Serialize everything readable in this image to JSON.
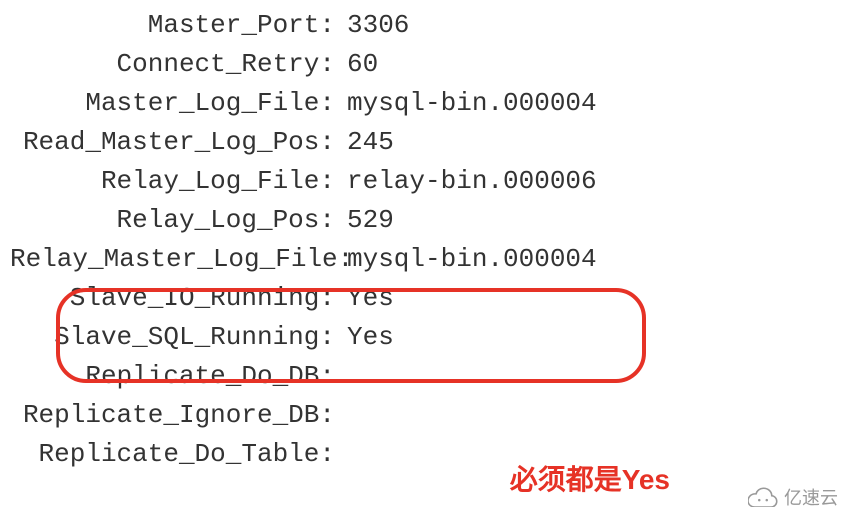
{
  "status": {
    "rows": [
      {
        "label": "Master_Port",
        "value": "3306"
      },
      {
        "label": "Connect_Retry",
        "value": "60"
      },
      {
        "label": "Master_Log_File",
        "value": "mysql-bin.000004"
      },
      {
        "label": "Read_Master_Log_Pos",
        "value": "245"
      },
      {
        "label": "Relay_Log_File",
        "value": "relay-bin.000006"
      },
      {
        "label": "Relay_Log_Pos",
        "value": "529"
      },
      {
        "label": "Relay_Master_Log_File",
        "value": "mysql-bin.000004"
      },
      {
        "label": "Slave_IO_Running",
        "value": "Yes"
      },
      {
        "label": "Slave_SQL_Running",
        "value": "Yes"
      },
      {
        "label": "Replicate_Do_DB",
        "value": ""
      },
      {
        "label": "Replicate_Ignore_DB",
        "value": ""
      },
      {
        "label": "Replicate_Do_Table",
        "value": ""
      }
    ]
  },
  "annotation": {
    "text": "必须都是Yes"
  },
  "watermark": {
    "text": "亿速云"
  }
}
